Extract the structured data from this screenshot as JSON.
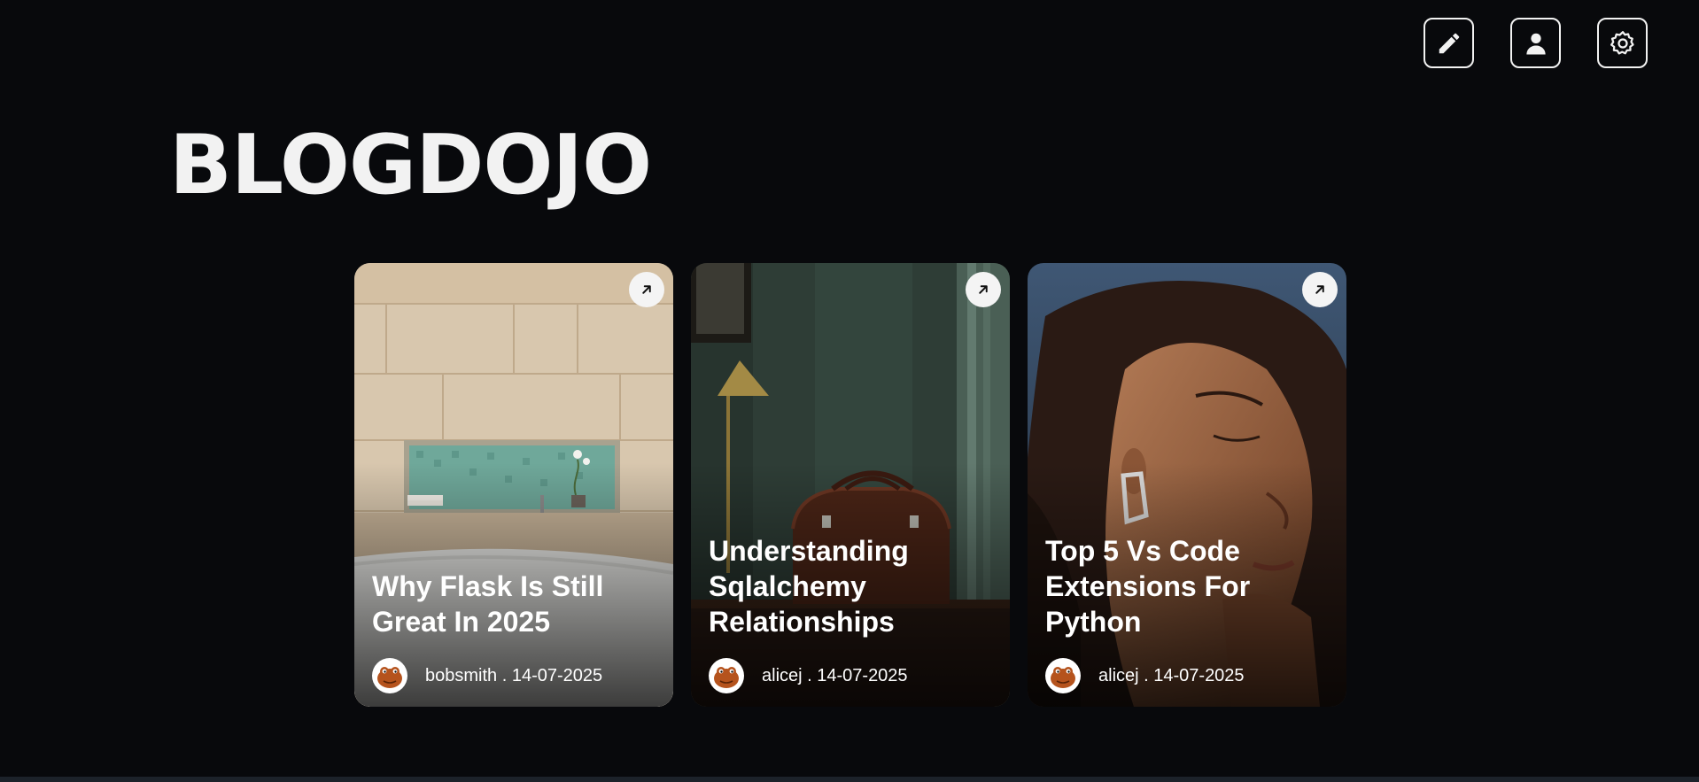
{
  "header": {
    "actions": [
      {
        "name": "write-button",
        "icon": "pencil-icon"
      },
      {
        "name": "profile-button",
        "icon": "user-icon"
      },
      {
        "name": "settings-button",
        "icon": "gear-icon"
      }
    ]
  },
  "brand": {
    "title": "BLOGDOJO"
  },
  "posts": [
    {
      "title": "Why Flask Is Still Great In 2025",
      "author": "bobsmith",
      "separator": " . ",
      "date": "14-07-2025",
      "image": "bathroom-bathtub-photo"
    },
    {
      "title": "Understanding Sqlalchemy Relationships",
      "author": "alicej",
      "separator": " . ",
      "date": "14-07-2025",
      "image": "leather-bag-lamp-photo"
    },
    {
      "title": "Top 5 Vs Code Extensions For Python",
      "author": "alicej",
      "separator": " . ",
      "date": "14-07-2025",
      "image": "woman-earring-portrait-photo"
    }
  ],
  "colors": {
    "background": "#08090c",
    "text": "#f2f2f2",
    "card_button": "#f4f4f4"
  }
}
